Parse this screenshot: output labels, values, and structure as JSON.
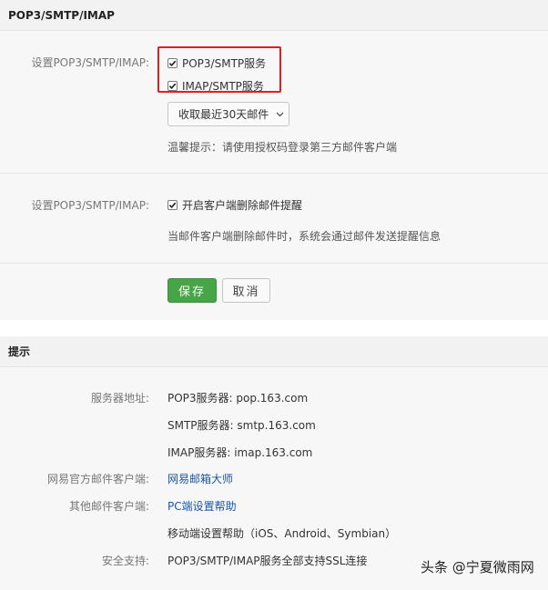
{
  "settings_header": {
    "title": "POP3/SMTP/IMAP"
  },
  "setting1": {
    "label": "设置POP3/SMTP/IMAP:",
    "option_pop3": "POP3/SMTP服务",
    "option_imap": "IMAP/SMTP服务",
    "pop3_checked": true,
    "imap_checked": true,
    "dropdown_value": "收取最近30天邮件",
    "tip": "温馨提示：请使用授权码登录第三方邮件客户端"
  },
  "setting2": {
    "label": "设置POP3/SMTP/IMAP:",
    "option_delete_alert": "开启客户端删除邮件提醒",
    "delete_alert_checked": true,
    "description": "当邮件客户端删除邮件时，系统会通过邮件发送提醒信息"
  },
  "buttons": {
    "save": "保存",
    "cancel": "取消"
  },
  "tips_header": {
    "title": "提示"
  },
  "tips": {
    "server_label": "服务器地址:",
    "pop3_server": "POP3服务器: pop.163.com",
    "smtp_server": "SMTP服务器: smtp.163.com",
    "imap_server": "IMAP服务器: imap.163.com",
    "official_client_label": "网易官方邮件客户端:",
    "official_client_link": "网易邮箱大师",
    "other_client_label": "其他邮件客户端:",
    "pc_setup_link": "PC端设置帮助",
    "mobile_setup": "移动端设置帮助（iOS、Android、Symbian）",
    "security_label": "安全支持:",
    "security_text": "POP3/SMTP/IMAP服务全部支持SSL连接"
  },
  "watermark": {
    "text": "头条 @宁夏微雨网"
  },
  "colors": {
    "save_green": "#47a447",
    "highlight_red": "#e02020",
    "link_blue": "#1a56a8"
  }
}
